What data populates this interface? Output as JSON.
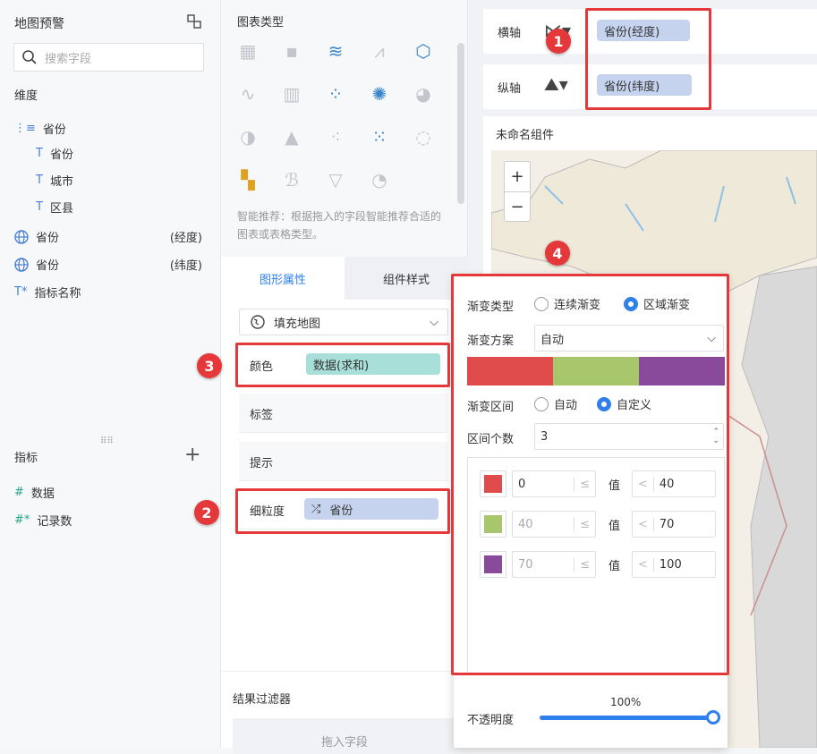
{
  "left": {
    "title": "地图预警",
    "search_placeholder": "搜索字段",
    "dimensions_label": "维度",
    "dim_group": "省份",
    "dim_children": [
      "省份",
      "城市",
      "区县"
    ],
    "geo_fields": [
      {
        "name": "省份",
        "tag": "(经度)"
      },
      {
        "name": "省份",
        "tag": "(纬度)"
      }
    ],
    "metric_name_field": "指标名称",
    "metrics_label": "指标",
    "metrics": [
      "数据",
      "记录数"
    ]
  },
  "mid": {
    "chart_type_title": "图表类型",
    "smart_tip": "智能推荐：根据拖入的字段智能推荐合适的图表或表格类型。",
    "tabs": [
      "图形属性",
      "组件样式"
    ],
    "map_type": "填充地图",
    "props": {
      "color": "颜色",
      "color_chip": "数据(求和)",
      "label": "标签",
      "tooltip": "提示",
      "granularity": "细粒度",
      "gran_chip": "省份"
    },
    "filter_title": "结果过滤器",
    "drop_field": "拖入字段"
  },
  "right": {
    "x_axis_label": "横轴",
    "y_axis_label": "纵轴",
    "x_chip": "省份(经度)",
    "y_chip": "省份(纬度)",
    "component_title": "未命名组件",
    "zoom_in": "+",
    "zoom_out": "−"
  },
  "gradient": {
    "type_label": "渐变类型",
    "type_options": [
      "连续渐变",
      "区域渐变"
    ],
    "scheme_label": "渐变方案",
    "scheme_value": "自动",
    "colors": [
      "#e04b4b",
      "#a8c66c",
      "#8a4a9c"
    ],
    "range_label": "渐变区间",
    "range_options": [
      "自动",
      "自定义"
    ],
    "count_label": "区间个数",
    "count_value": "3",
    "rows": [
      {
        "color": "#e04b4b",
        "from": "0",
        "to": "40"
      },
      {
        "color": "#a8c66c",
        "from": "40",
        "to": "70"
      },
      {
        "color": "#8a4a9c",
        "from": "70",
        "to": "100"
      }
    ],
    "value_label": "值",
    "opacity_label": "不透明度",
    "opacity_value": "100%",
    "opacity_fraction": 1.0
  },
  "badges": [
    "1",
    "2",
    "3",
    "4"
  ]
}
